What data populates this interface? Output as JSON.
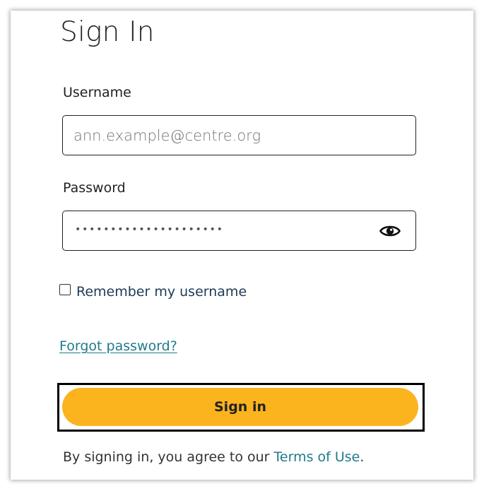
{
  "form": {
    "title": "Sign In",
    "username": {
      "label": "Username",
      "placeholder": "ann.example@centre.org",
      "value": ""
    },
    "password": {
      "label": "Password",
      "masked_value": "•••••••••••••••••••••",
      "toggle_icon": "eye-icon"
    },
    "remember": {
      "label": "Remember my username",
      "checked": false
    },
    "forgot_link": "Forgot password?",
    "submit_label": "Sign in",
    "terms": {
      "prefix": "By signing in, you agree to our ",
      "link": "Terms of Use",
      "suffix": "."
    }
  },
  "colors": {
    "button": "#fbb41e",
    "link": "#1f7a8c",
    "remember_text": "#1d3a55"
  }
}
